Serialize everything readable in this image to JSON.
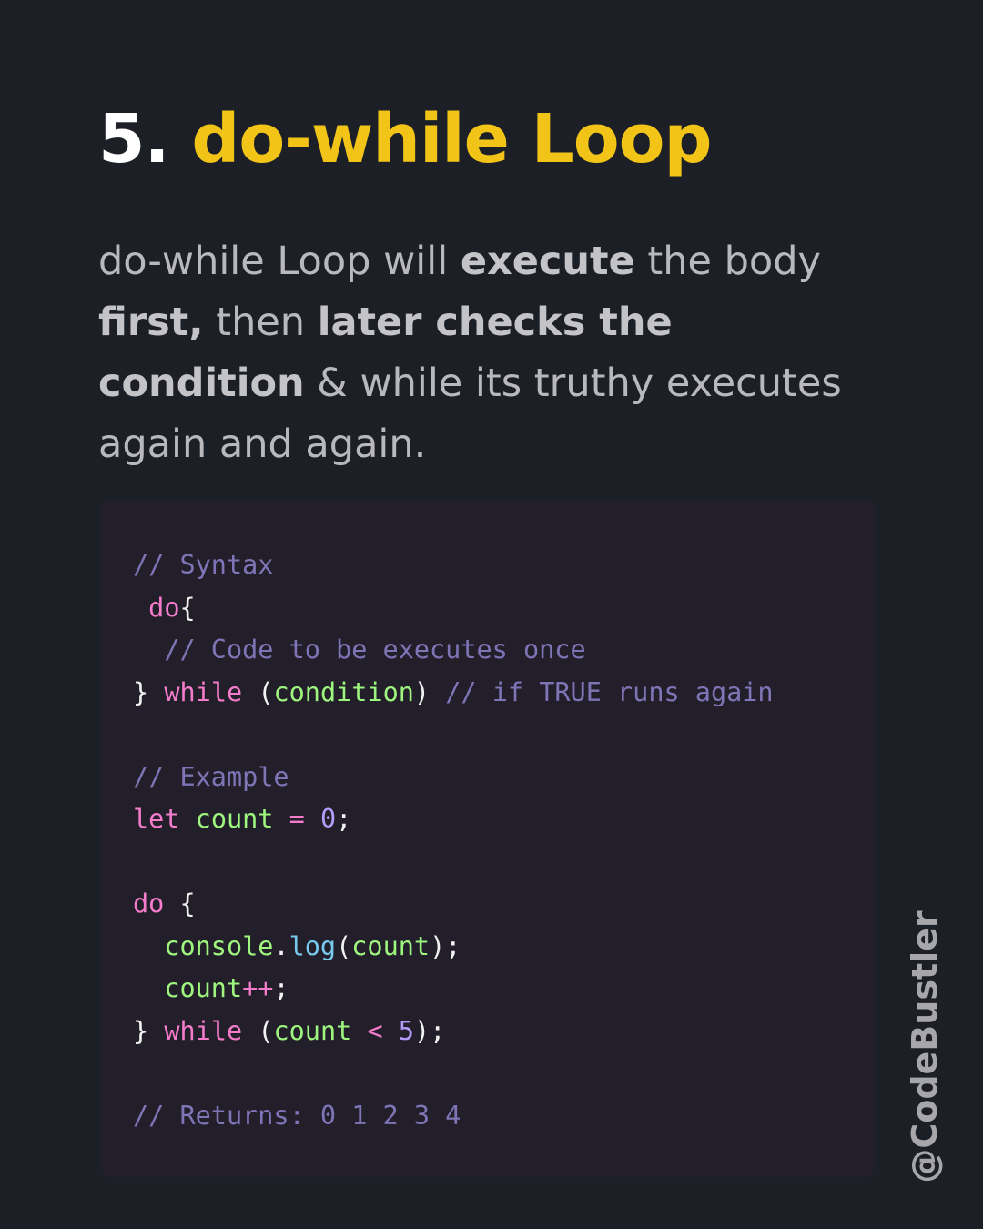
{
  "title": {
    "number": "5.",
    "name": "do-while Loop"
  },
  "description": {
    "p1": "do-while Loop will ",
    "b1": "execute",
    "p2": " the body ",
    "b2": "first,",
    "p3": " then ",
    "b3": "later checks the condition",
    "p4": " & while its truthy executes again and again."
  },
  "code": {
    "l1": {
      "comment": "// Syntax"
    },
    "l2": {
      "kw": "do",
      "brace": "{"
    },
    "l3": {
      "comment": "// Code to be executes once"
    },
    "l4": {
      "close": "}",
      "kw": "while",
      "open": "(",
      "cond": "condition",
      "end": ")",
      "comment": "// if TRUE runs again"
    },
    "l6": {
      "comment": "// Example"
    },
    "l7": {
      "kw": "let",
      "var": "count",
      "op": "=",
      "num": "0",
      "semi": ";"
    },
    "l9": {
      "kw": "do",
      "brace": "{"
    },
    "l10": {
      "obj": "console",
      "dot": ".",
      "fn": "log",
      "open": "(",
      "arg": "count",
      "end": ");"
    },
    "l11": {
      "var": "count",
      "op": "++",
      "semi": ";"
    },
    "l12": {
      "close": "}",
      "kw": "while",
      "open": "(",
      "var": "count",
      "op": "<",
      "num": "5",
      "end": ");"
    },
    "l14": {
      "comment": "// Returns: 0 1 2 3 4"
    }
  },
  "watermark": "@CodeBustler"
}
